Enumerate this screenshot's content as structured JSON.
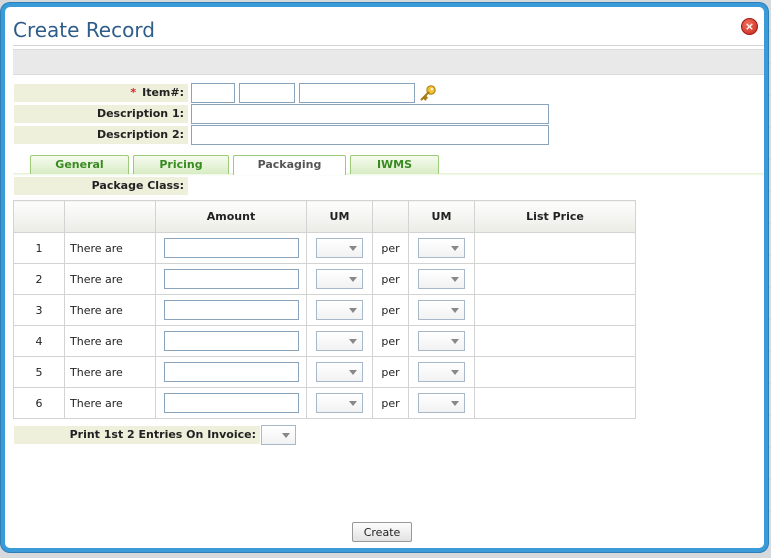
{
  "dialog": {
    "title": "Create Record",
    "close_label": "×",
    "create_label": "Create"
  },
  "form": {
    "required_mark": "*",
    "item_label": "Item#:",
    "description1_label": "Description 1:",
    "description2_label": "Description 2:",
    "item_part1": "",
    "item_part2": "",
    "item_part3": "",
    "description1": "",
    "description2": ""
  },
  "tabs": [
    {
      "label": "General",
      "active": false
    },
    {
      "label": "Pricing",
      "active": false
    },
    {
      "label": "Packaging",
      "active": true
    },
    {
      "label": "IWMS",
      "active": false
    }
  ],
  "packaging": {
    "package_class_label": "Package Class:",
    "columns": [
      "",
      "",
      "Amount",
      "UM",
      "",
      "UM",
      "List Price"
    ],
    "rows": [
      {
        "num": "1",
        "text": "There are",
        "per": "per"
      },
      {
        "num": "2",
        "text": "There are",
        "per": "per"
      },
      {
        "num": "3",
        "text": "There are",
        "per": "per"
      },
      {
        "num": "4",
        "text": "There are",
        "per": "per"
      },
      {
        "num": "5",
        "text": "There are",
        "per": "per"
      },
      {
        "num": "6",
        "text": "There are",
        "per": "per"
      }
    ],
    "print_label": "Print 1st 2 Entries On Invoice:"
  },
  "colors": {
    "dialog_border": "#3b9ad8",
    "title_text": "#2f5d8a",
    "label_background": "#eef0dc",
    "tab_text": "#3a8a22",
    "required": "#dd2222"
  },
  "icons": {
    "close": "close-icon",
    "key": "key-icon",
    "dropdown": "chevron-down-icon"
  }
}
